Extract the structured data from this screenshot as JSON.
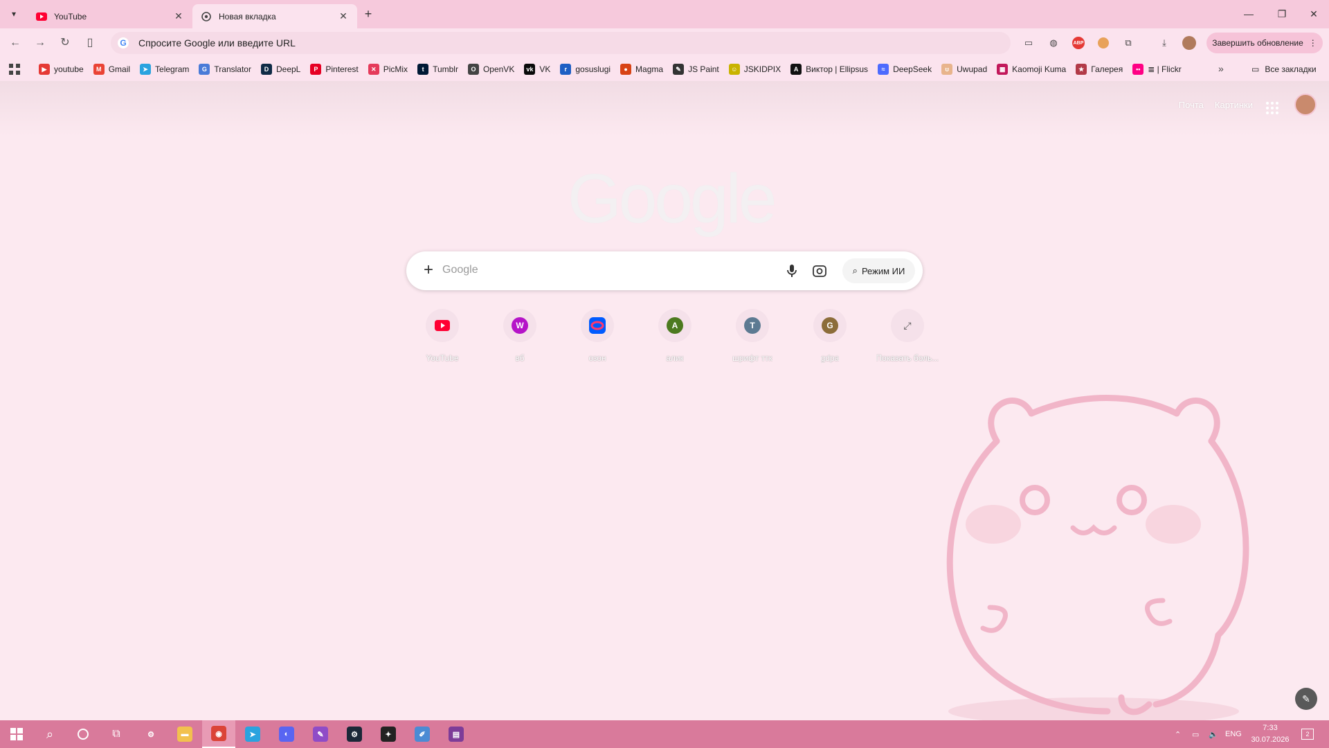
{
  "tabs": [
    {
      "title": "YouTube",
      "icon": "youtube-icon",
      "active": false
    },
    {
      "title": "Новая вкладка",
      "icon": "chrome-icon",
      "active": true
    }
  ],
  "omnibox": {
    "placeholder": "Спросите Google или введите URL"
  },
  "update_button": "Завершить обновление",
  "bookmarks": [
    {
      "label": "youtube",
      "color": "#e53935",
      "glyph": "▶"
    },
    {
      "label": "Gmail",
      "color": "#ea4335",
      "glyph": "M"
    },
    {
      "label": "Telegram",
      "color": "#2aa3df",
      "glyph": "➤"
    },
    {
      "label": "Translator",
      "color": "#4a7bd8",
      "glyph": "G"
    },
    {
      "label": "DeepL",
      "color": "#0f2b46",
      "glyph": "D"
    },
    {
      "label": "Pinterest",
      "color": "#e60023",
      "glyph": "P"
    },
    {
      "label": "PicMix",
      "color": "#e53a5a",
      "glyph": "✕"
    },
    {
      "label": "Tumblr",
      "color": "#001935",
      "glyph": "t"
    },
    {
      "label": "OpenVK",
      "color": "#444444",
      "glyph": "O"
    },
    {
      "label": "VK",
      "color": "#0a0a0a",
      "glyph": "vk"
    },
    {
      "label": "gosuslugi",
      "color": "#1e5fc4",
      "glyph": "г"
    },
    {
      "label": "Magma",
      "color": "#d84315",
      "glyph": "●"
    },
    {
      "label": "JS Paint",
      "color": "#333333",
      "glyph": "✎"
    },
    {
      "label": "JSKIDPIX",
      "color": "#c9b300",
      "glyph": "☺"
    },
    {
      "label": "Виктор | Ellipsus",
      "color": "#111111",
      "glyph": "A"
    },
    {
      "label": "DeepSeek",
      "color": "#4d6bfe",
      "glyph": "≈"
    },
    {
      "label": "Uwupad",
      "color": "#e8b48c",
      "glyph": "ʊ"
    },
    {
      "label": "Kaomoji Kuma",
      "color": "#c2185b",
      "glyph": "▦"
    },
    {
      "label": "Галерея",
      "color": "#b23a48",
      "glyph": "★"
    },
    {
      "label": "≣ | Flickr",
      "color": "#ff0084",
      "glyph": "••"
    }
  ],
  "all_bookmarks": "Все закладки",
  "top_links": {
    "mail": "Почта",
    "images": "Картинки"
  },
  "search": {
    "placeholder": "Google",
    "ai_mode": "Режим ИИ"
  },
  "shortcuts": [
    {
      "label": "YouTube",
      "kind": "youtube",
      "letter": "",
      "color": "#ff0033"
    },
    {
      "label": "вб",
      "kind": "letter",
      "letter": "W",
      "color": "#b514c8"
    },
    {
      "label": "озон",
      "kind": "ozon",
      "letter": "",
      "color": "#005bff"
    },
    {
      "label": "алик",
      "kind": "letter",
      "letter": "A",
      "color": "#4c7a1f"
    },
    {
      "label": "шрифт ттк",
      "kind": "letter",
      "letter": "T",
      "color": "#5c7a92"
    },
    {
      "label": "gdpa",
      "kind": "letter",
      "letter": "G",
      "color": "#8c6d3a"
    },
    {
      "label": "Показать боль...",
      "kind": "expand",
      "letter": "",
      "color": "#555555"
    }
  ],
  "taskbar": {
    "apps": [
      {
        "name": "settings-app",
        "color": "#d97a9b",
        "glyph": "⚙"
      },
      {
        "name": "explorer-app",
        "color": "#f2c14e",
        "glyph": "▬"
      },
      {
        "name": "chrome-app",
        "color": "#db4437",
        "glyph": "◉",
        "active": true
      },
      {
        "name": "telegram-app",
        "color": "#2aa3df",
        "glyph": "➤"
      },
      {
        "name": "discord-app",
        "color": "#5865f2",
        "glyph": "◐"
      },
      {
        "name": "krita-app",
        "color": "#8f4cc7",
        "glyph": "✎"
      },
      {
        "name": "steam-app",
        "color": "#1b2838",
        "glyph": "⚙"
      },
      {
        "name": "game-app",
        "color": "#222222",
        "glyph": "✦"
      },
      {
        "name": "paint-app",
        "color": "#4b8bd4",
        "glyph": "✐"
      },
      {
        "name": "winrar-app",
        "color": "#7d3c98",
        "glyph": "▤"
      }
    ],
    "lang": "ENG",
    "time": "7:33",
    "date": "30.07.2026",
    "notifications": "2"
  }
}
